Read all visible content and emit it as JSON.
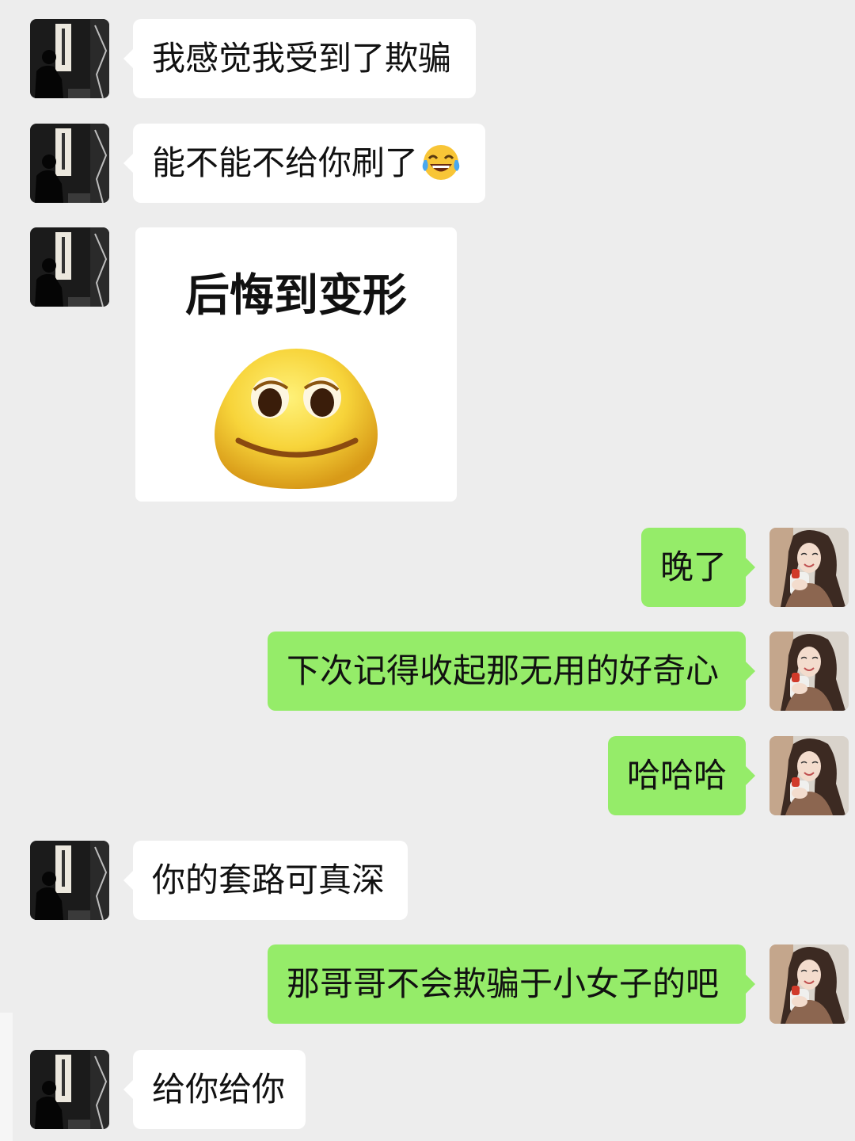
{
  "chat": {
    "contact_avatar_icon": "seated-man-calligraphy-avatar",
    "self_avatar_icon": "girl-portrait-avatar",
    "incoming_bubble_color": "#ffffff",
    "outgoing_bubble_color": "#95ec69",
    "background_color": "#ededed",
    "messages": [
      {
        "from": "contact",
        "type": "text",
        "text": "我感觉我受到了欺骗"
      },
      {
        "from": "contact",
        "type": "text",
        "text": "能不能不给你刷了",
        "emoji": "tears-of-joy-emoji"
      },
      {
        "from": "contact",
        "type": "sticker",
        "caption": "后悔到变形",
        "icon": "smiling-blob-face-emoji"
      },
      {
        "from": "self",
        "type": "text",
        "text": "晚了"
      },
      {
        "from": "self",
        "type": "text",
        "text": "下次记得收起那无用的好奇心"
      },
      {
        "from": "self",
        "type": "text",
        "text": "哈哈哈"
      },
      {
        "from": "contact",
        "type": "text",
        "text": "你的套路可真深"
      },
      {
        "from": "self",
        "type": "text",
        "text": "那哥哥不会欺骗于小女子的吧"
      },
      {
        "from": "contact",
        "type": "text",
        "text": "给你给你"
      }
    ]
  }
}
